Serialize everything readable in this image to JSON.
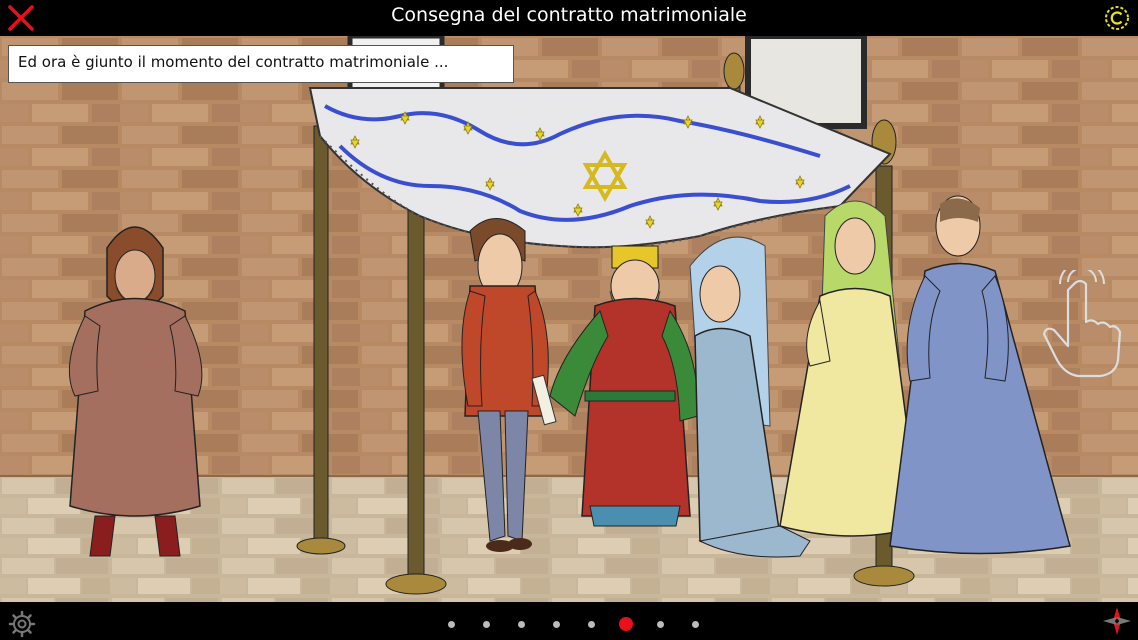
{
  "header": {
    "title": "Consegna del contratto matrimoniale"
  },
  "narration": {
    "text": "Ed ora è giunto il momento del contratto matrimoniale ..."
  },
  "pager": {
    "count": 8,
    "active_index": 5
  },
  "icons": {
    "close": "close-icon",
    "credits": "copyright-icon",
    "settings": "settings-gear-icon",
    "navigate": "navigation-compass-icon",
    "tap_hint": "tap-hand-icon"
  },
  "colors": {
    "close": "#e8101a",
    "credits": "#e9e21a",
    "active_dot": "#e8101a",
    "inactive_dot": "#bbbbbb",
    "canopy_star": "#e9d42a",
    "canopy_stripe": "#3a4fd0"
  }
}
